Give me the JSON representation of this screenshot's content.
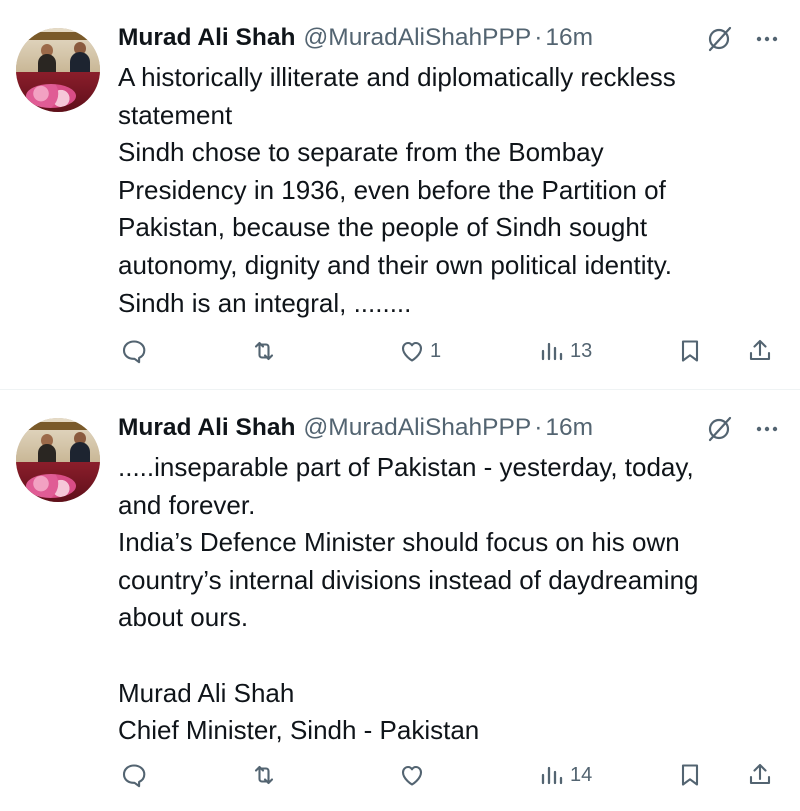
{
  "tweets": [
    {
      "author_name": "Murad Ali Shah",
      "handle": "@MuradAliShahPPP",
      "separator": "·",
      "time": "16m",
      "lines": [
        "A historically illiterate and diplomatically reckless",
        "statement",
        "Sindh chose to separate from the Bombay",
        "Presidency in 1936, even before the Partition of",
        "Pakistan, because the people of Sindh sought",
        "autonomy, dignity and their own political identity.",
        "Sindh is an integral, ........"
      ],
      "counts": {
        "reply": "",
        "repost": "",
        "like": "1",
        "views": "13"
      }
    },
    {
      "author_name": "Murad Ali Shah",
      "handle": "@MuradAliShahPPP",
      "separator": "·",
      "time": "16m",
      "lines": [
        ".....inseparable part of Pakistan - yesterday, today,",
        "and forever.",
        "India’s Defence Minister should focus on his own",
        "country’s internal divisions instead of daydreaming",
        "about ours.",
        "",
        "Murad Ali Shah",
        "Chief Minister, Sindh - Pakistan"
      ],
      "counts": {
        "reply": "",
        "repost": "",
        "like": "",
        "views": "14"
      }
    }
  ],
  "icons": {
    "reply": "reply-icon",
    "repost": "repost-icon",
    "like": "like-icon",
    "views": "views-icon",
    "bookmark": "bookmark-icon",
    "share": "share-icon",
    "grok": "grok-icon",
    "more": "more-icon"
  },
  "colors": {
    "text": "#0f1419",
    "secondary": "#536471",
    "divider": "#eff3f4"
  }
}
